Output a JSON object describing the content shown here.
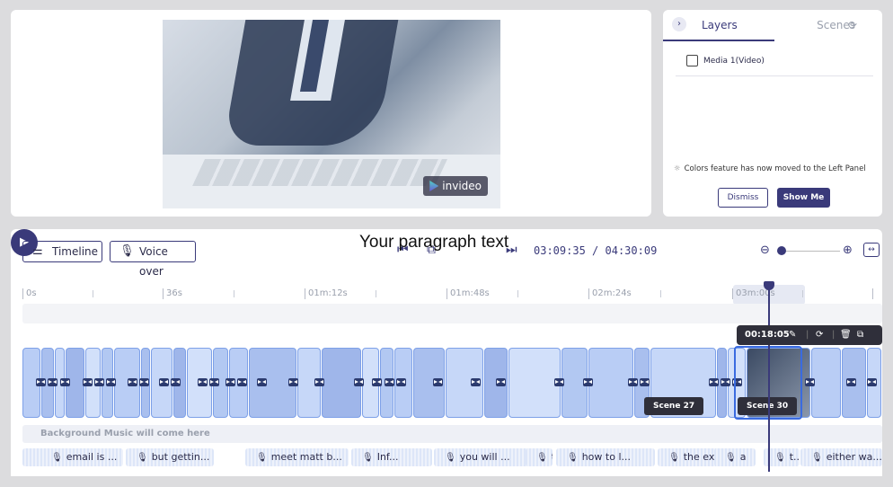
{
  "preview": {
    "watermark_label": "invideo",
    "overlay_text": "Your paragraph text"
  },
  "side_panel": {
    "tab_layers": "Layers",
    "tab_scenes": "Scenes",
    "layer_item": "Media 1(Video)",
    "notice": "Colors feature has now moved to the Left Panel",
    "dismiss_label": "Dismiss",
    "show_me_label": "Show Me"
  },
  "toolbar": {
    "timeline_label": "Timeline",
    "voiceover_label": "Voice over",
    "current_time": "03:09:35",
    "separator": "/",
    "total_time": "04:30:09"
  },
  "ruler": {
    "ticks": [
      "0s",
      "36s",
      "01m:12s",
      "01m:48s",
      "02m:24s",
      "03m:00s",
      ""
    ]
  },
  "clip_toolbar": {
    "duration": "00:18:05"
  },
  "scenes": {
    "scene_27": "Scene 27",
    "scene_30": "Scene 30"
  },
  "music_track": {
    "label": "Background Music will come here"
  },
  "voice_segments": [
    "email is ...",
    "but gettin...",
    "meet matt b...",
    "Inf...",
    "you will ...",
    "t.",
    "how to l...",
    "the ex...",
    "a",
    "t...",
    "either wa..."
  ],
  "colors": {
    "accent": "#3a3a7a",
    "clip_fill": "#c9daf8",
    "clip_border": "#7da0e8"
  }
}
